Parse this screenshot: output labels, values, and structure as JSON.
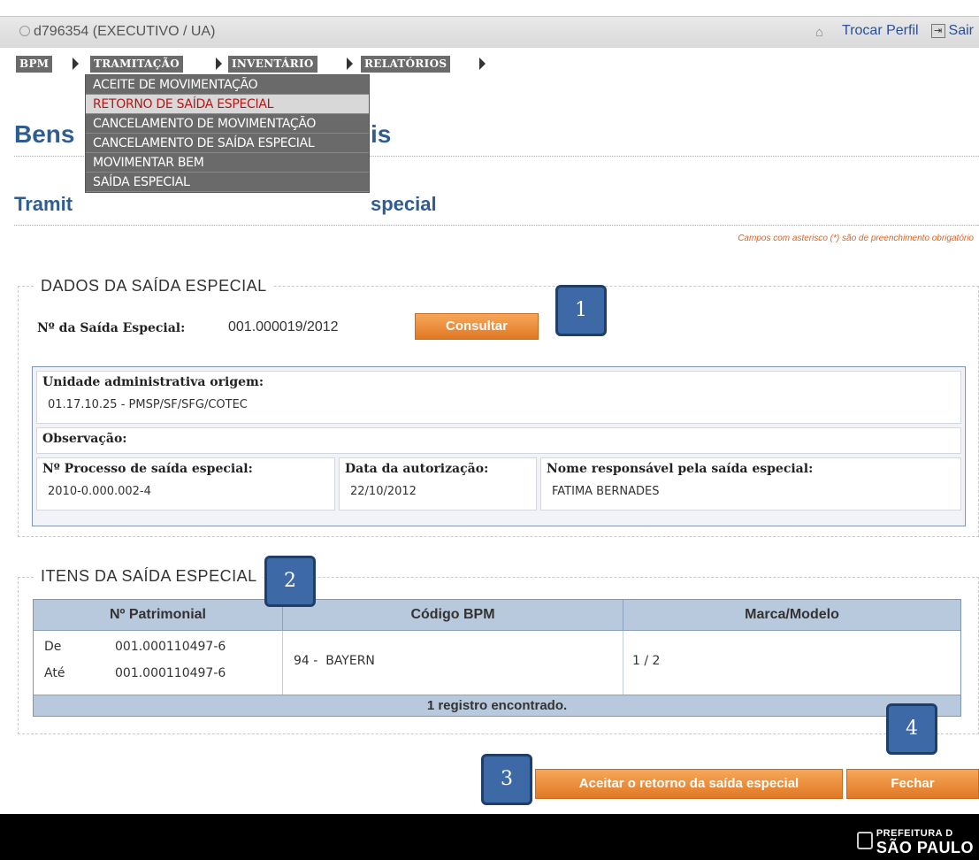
{
  "topbar": {
    "user": "d796354 (EXECUTIVO / UA)",
    "change_profile": "Trocar Perfil",
    "exit": "Sair"
  },
  "menu": [
    {
      "label": "BPM"
    },
    {
      "label": "TRAMITAÇÃO"
    },
    {
      "label": "INVENTÁRIO"
    },
    {
      "label": "RELATÓRIOS"
    }
  ],
  "dropdown": [
    {
      "label": "ACEITE DE MOVIMENTAÇÃO"
    },
    {
      "label": "RETORNO DE SAÍDA ESPECIAL",
      "active": true
    },
    {
      "label": "CANCELAMENTO DE MOVIMENTAÇÃO"
    },
    {
      "label": "CANCELAMENTO DE SAÍDA ESPECIAL"
    },
    {
      "label": "MOVIMENTAR BEM"
    },
    {
      "label": "SAÍDA ESPECIAL"
    }
  ],
  "page": {
    "title_start": "Bens",
    "title_end": "is",
    "subtitle_start": "Tramit",
    "subtitle_end": "special",
    "required_note": "Campos com asterisco (*) são de preenchimento obrigatório"
  },
  "dados": {
    "legend": "DADOS DA SAÍDA ESPECIAL",
    "numero_label": "Nº da Saída Especial:",
    "numero_value": "001.000019/2012",
    "consultar": "Consultar",
    "unidade_label": "Unidade administrativa origem:",
    "unidade_value": "01.17.10.25 - PMSP/SF/SFG/COTEC",
    "observacao_label": "Observação:",
    "processo_label": "Nº Processo de saída especial:",
    "processo_value": "2010-0.000.002-4",
    "data_label": "Data da autorização:",
    "data_value": "22/10/2012",
    "responsavel_label": "Nome responsável pela saída especial:",
    "responsavel_value": "FATIMA BERNADES"
  },
  "itens": {
    "legend": "ITENS DA SAÍDA ESPECIAL",
    "columns": [
      "Nº Patrimonial",
      "Código BPM",
      "Marca/Modelo"
    ],
    "rows": [
      {
        "de_label": "De",
        "de_value": "001.000110497-6",
        "ate_label": "Até",
        "ate_value": "001.000110497-6",
        "codigo": "94 -  BAYERN",
        "marca": "1 / 2"
      }
    ],
    "footer": "1 registro encontrado."
  },
  "actions": {
    "aceitar": "Aceitar o retorno da saída especial",
    "fechar": "Fechar"
  },
  "callouts": [
    "1",
    "2",
    "3",
    "4"
  ],
  "footer": {
    "logo_line1": "PREFEITURA D",
    "logo_line2": "SÃO PAULO"
  },
  "colors": {
    "accent_orange": "#e07824",
    "heading_blue": "#2f5d8f",
    "callout_blue": "#3d6aa6",
    "active_menu_red": "#b01818"
  }
}
